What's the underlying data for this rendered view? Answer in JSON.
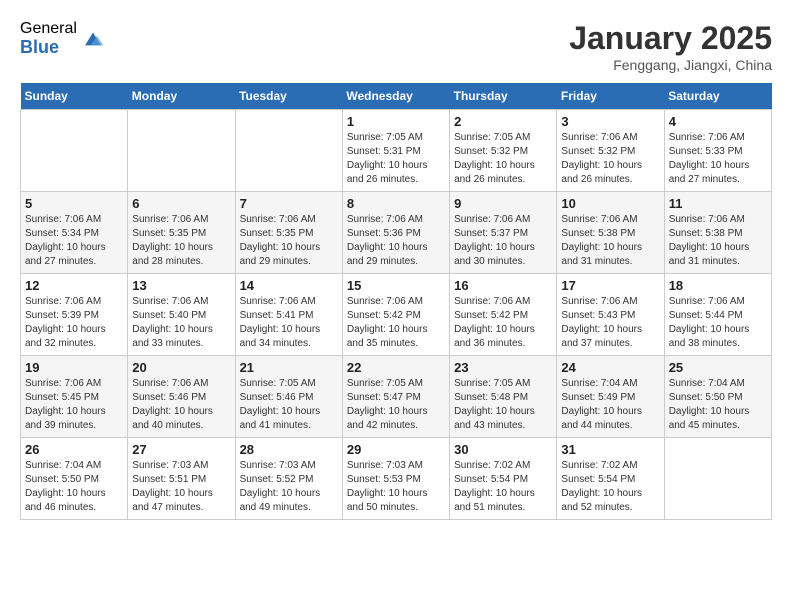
{
  "logo": {
    "general": "General",
    "blue": "Blue"
  },
  "title": "January 2025",
  "location": "Fenggang, Jiangxi, China",
  "weekdays": [
    "Sunday",
    "Monday",
    "Tuesday",
    "Wednesday",
    "Thursday",
    "Friday",
    "Saturday"
  ],
  "weeks": [
    [
      {
        "day": "",
        "info": ""
      },
      {
        "day": "",
        "info": ""
      },
      {
        "day": "",
        "info": ""
      },
      {
        "day": "1",
        "info": "Sunrise: 7:05 AM\nSunset: 5:31 PM\nDaylight: 10 hours\nand 26 minutes."
      },
      {
        "day": "2",
        "info": "Sunrise: 7:05 AM\nSunset: 5:32 PM\nDaylight: 10 hours\nand 26 minutes."
      },
      {
        "day": "3",
        "info": "Sunrise: 7:06 AM\nSunset: 5:32 PM\nDaylight: 10 hours\nand 26 minutes."
      },
      {
        "day": "4",
        "info": "Sunrise: 7:06 AM\nSunset: 5:33 PM\nDaylight: 10 hours\nand 27 minutes."
      }
    ],
    [
      {
        "day": "5",
        "info": "Sunrise: 7:06 AM\nSunset: 5:34 PM\nDaylight: 10 hours\nand 27 minutes."
      },
      {
        "day": "6",
        "info": "Sunrise: 7:06 AM\nSunset: 5:35 PM\nDaylight: 10 hours\nand 28 minutes."
      },
      {
        "day": "7",
        "info": "Sunrise: 7:06 AM\nSunset: 5:35 PM\nDaylight: 10 hours\nand 29 minutes."
      },
      {
        "day": "8",
        "info": "Sunrise: 7:06 AM\nSunset: 5:36 PM\nDaylight: 10 hours\nand 29 minutes."
      },
      {
        "day": "9",
        "info": "Sunrise: 7:06 AM\nSunset: 5:37 PM\nDaylight: 10 hours\nand 30 minutes."
      },
      {
        "day": "10",
        "info": "Sunrise: 7:06 AM\nSunset: 5:38 PM\nDaylight: 10 hours\nand 31 minutes."
      },
      {
        "day": "11",
        "info": "Sunrise: 7:06 AM\nSunset: 5:38 PM\nDaylight: 10 hours\nand 31 minutes."
      }
    ],
    [
      {
        "day": "12",
        "info": "Sunrise: 7:06 AM\nSunset: 5:39 PM\nDaylight: 10 hours\nand 32 minutes."
      },
      {
        "day": "13",
        "info": "Sunrise: 7:06 AM\nSunset: 5:40 PM\nDaylight: 10 hours\nand 33 minutes."
      },
      {
        "day": "14",
        "info": "Sunrise: 7:06 AM\nSunset: 5:41 PM\nDaylight: 10 hours\nand 34 minutes."
      },
      {
        "day": "15",
        "info": "Sunrise: 7:06 AM\nSunset: 5:42 PM\nDaylight: 10 hours\nand 35 minutes."
      },
      {
        "day": "16",
        "info": "Sunrise: 7:06 AM\nSunset: 5:42 PM\nDaylight: 10 hours\nand 36 minutes."
      },
      {
        "day": "17",
        "info": "Sunrise: 7:06 AM\nSunset: 5:43 PM\nDaylight: 10 hours\nand 37 minutes."
      },
      {
        "day": "18",
        "info": "Sunrise: 7:06 AM\nSunset: 5:44 PM\nDaylight: 10 hours\nand 38 minutes."
      }
    ],
    [
      {
        "day": "19",
        "info": "Sunrise: 7:06 AM\nSunset: 5:45 PM\nDaylight: 10 hours\nand 39 minutes."
      },
      {
        "day": "20",
        "info": "Sunrise: 7:06 AM\nSunset: 5:46 PM\nDaylight: 10 hours\nand 40 minutes."
      },
      {
        "day": "21",
        "info": "Sunrise: 7:05 AM\nSunset: 5:46 PM\nDaylight: 10 hours\nand 41 minutes."
      },
      {
        "day": "22",
        "info": "Sunrise: 7:05 AM\nSunset: 5:47 PM\nDaylight: 10 hours\nand 42 minutes."
      },
      {
        "day": "23",
        "info": "Sunrise: 7:05 AM\nSunset: 5:48 PM\nDaylight: 10 hours\nand 43 minutes."
      },
      {
        "day": "24",
        "info": "Sunrise: 7:04 AM\nSunset: 5:49 PM\nDaylight: 10 hours\nand 44 minutes."
      },
      {
        "day": "25",
        "info": "Sunrise: 7:04 AM\nSunset: 5:50 PM\nDaylight: 10 hours\nand 45 minutes."
      }
    ],
    [
      {
        "day": "26",
        "info": "Sunrise: 7:04 AM\nSunset: 5:50 PM\nDaylight: 10 hours\nand 46 minutes."
      },
      {
        "day": "27",
        "info": "Sunrise: 7:03 AM\nSunset: 5:51 PM\nDaylight: 10 hours\nand 47 minutes."
      },
      {
        "day": "28",
        "info": "Sunrise: 7:03 AM\nSunset: 5:52 PM\nDaylight: 10 hours\nand 49 minutes."
      },
      {
        "day": "29",
        "info": "Sunrise: 7:03 AM\nSunset: 5:53 PM\nDaylight: 10 hours\nand 50 minutes."
      },
      {
        "day": "30",
        "info": "Sunrise: 7:02 AM\nSunset: 5:54 PM\nDaylight: 10 hours\nand 51 minutes."
      },
      {
        "day": "31",
        "info": "Sunrise: 7:02 AM\nSunset: 5:54 PM\nDaylight: 10 hours\nand 52 minutes."
      },
      {
        "day": "",
        "info": ""
      }
    ]
  ]
}
